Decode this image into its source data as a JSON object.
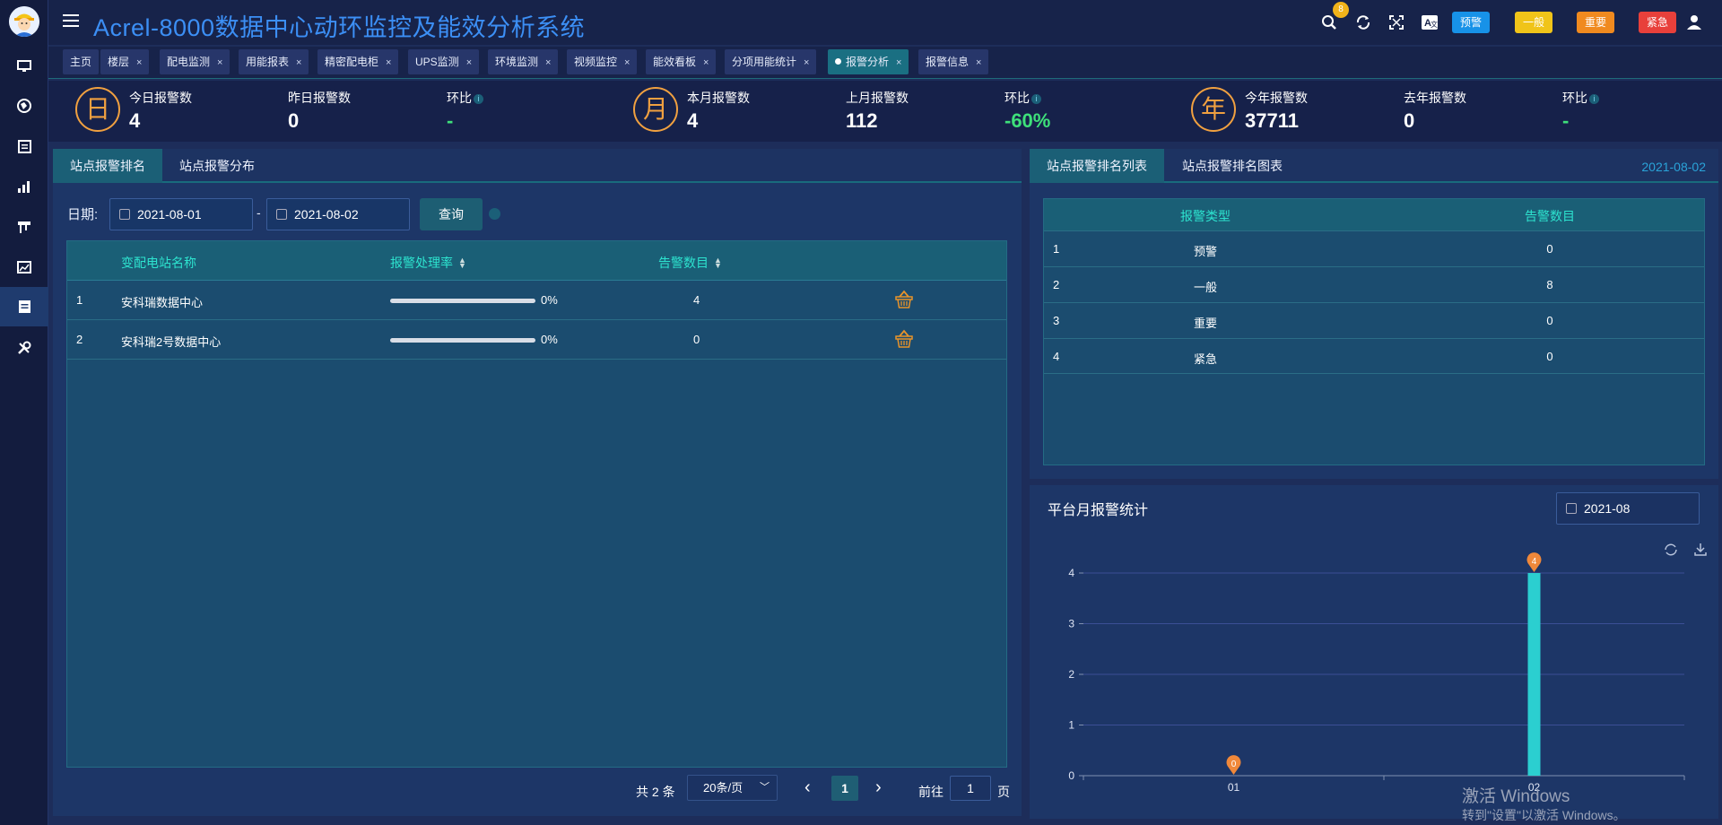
{
  "app": {
    "title": "Acrel-8000数据中心动环监控及能效分析系统"
  },
  "sidebar": {
    "items": [
      "monitor-icon",
      "globe-icon",
      "document-icon",
      "bar-chart-icon",
      "tool-rack-icon",
      "report-icon",
      "alarm-list-icon",
      "wrench-icon"
    ],
    "active_index": 6
  },
  "toolbar": {
    "icons": [
      "search-icon",
      "refresh-icon",
      "fullscreen-icon",
      "translate-icon",
      "user-icon"
    ],
    "levels": [
      {
        "label": "预警",
        "color": "#1792e8"
      },
      {
        "label": "一般",
        "color": "#f0c419"
      },
      {
        "label": "重要",
        "color": "#f08a1f"
      },
      {
        "label": "紧急",
        "color": "#e8403b"
      }
    ],
    "badge_count": "8"
  },
  "tabs": [
    {
      "label": "主页",
      "closable": false
    },
    {
      "label": "楼层",
      "closable": true
    },
    {
      "label": "配电监测",
      "closable": true
    },
    {
      "label": "用能报表",
      "closable": true
    },
    {
      "label": "精密配电柜",
      "closable": true
    },
    {
      "label": "UPS监测",
      "closable": true
    },
    {
      "label": "环境监测",
      "closable": true
    },
    {
      "label": "视频监控",
      "closable": true
    },
    {
      "label": "能效看板",
      "closable": true
    },
    {
      "label": "分项用能统计",
      "closable": true
    },
    {
      "label": "报警分析",
      "closable": true,
      "active": true
    },
    {
      "label": "报警信息",
      "closable": true
    }
  ],
  "stats": {
    "day": {
      "icon": "日",
      "today_label": "今日报警数",
      "today": "4",
      "yesterday_label": "昨日报警数",
      "yesterday": "0",
      "ratio_label": "环比",
      "ratio": "-"
    },
    "month": {
      "icon": "月",
      "current_label": "本月报警数",
      "current": "4",
      "last_label": "上月报警数",
      "last": "112",
      "ratio_label": "环比",
      "ratio": "-60%"
    },
    "year": {
      "icon": "年",
      "current_label": "今年报警数",
      "current": "37711",
      "last_label": "去年报警数",
      "last": "0",
      "ratio_label": "环比",
      "ratio": "-"
    }
  },
  "left_panel": {
    "tabs": [
      "站点报警排名",
      "站点报警分布"
    ],
    "date_label": "日期:",
    "start_date": "2021-08-01",
    "separator": "-",
    "end_date": "2021-08-02",
    "query_label": "查询",
    "table": {
      "headers": [
        "变配电站名称",
        "报警处理率",
        "告警数目"
      ],
      "rows": [
        {
          "index": "1",
          "name": "安科瑞数据中心",
          "rate": 0,
          "rate_label": "0%",
          "count": "4"
        },
        {
          "index": "2",
          "name": "安科瑞2号数据中心",
          "rate": 0,
          "rate_label": "0%",
          "count": "0"
        }
      ]
    },
    "pager": {
      "total": "共 2 条",
      "page_size": "20条/页",
      "prev": "‹",
      "current": "1",
      "next": "›",
      "goto_label": "前往",
      "goto_value": "1",
      "page_suffix": "页"
    }
  },
  "right_top": {
    "tabs": [
      "站点报警排名列表",
      "站点报警排名图表"
    ],
    "date": "2021-08-02",
    "table": {
      "headers": [
        "报警类型",
        "告警数目"
      ],
      "rows": [
        {
          "index": "1",
          "type": "预警",
          "count": "0"
        },
        {
          "index": "2",
          "type": "一般",
          "count": "8"
        },
        {
          "index": "3",
          "type": "重要",
          "count": "0"
        },
        {
          "index": "4",
          "type": "紧急",
          "count": "0"
        }
      ]
    }
  },
  "right_bottom": {
    "title": "平台月报警统计",
    "month": "2021-08"
  },
  "chart_data": {
    "type": "bar",
    "title": "",
    "categories": [
      "01",
      "02"
    ],
    "values": [
      0,
      4
    ],
    "ylim": [
      0,
      4
    ],
    "yticks": [
      0,
      1,
      2,
      3,
      4
    ],
    "point_labels": [
      "0",
      "4"
    ],
    "bar_color": "#2bcfd0",
    "marker_color": "#f0883a",
    "grid": true
  },
  "watermark": {
    "line1": "激活 Windows",
    "line2": "转到\"设置\"以激活 Windows。"
  }
}
